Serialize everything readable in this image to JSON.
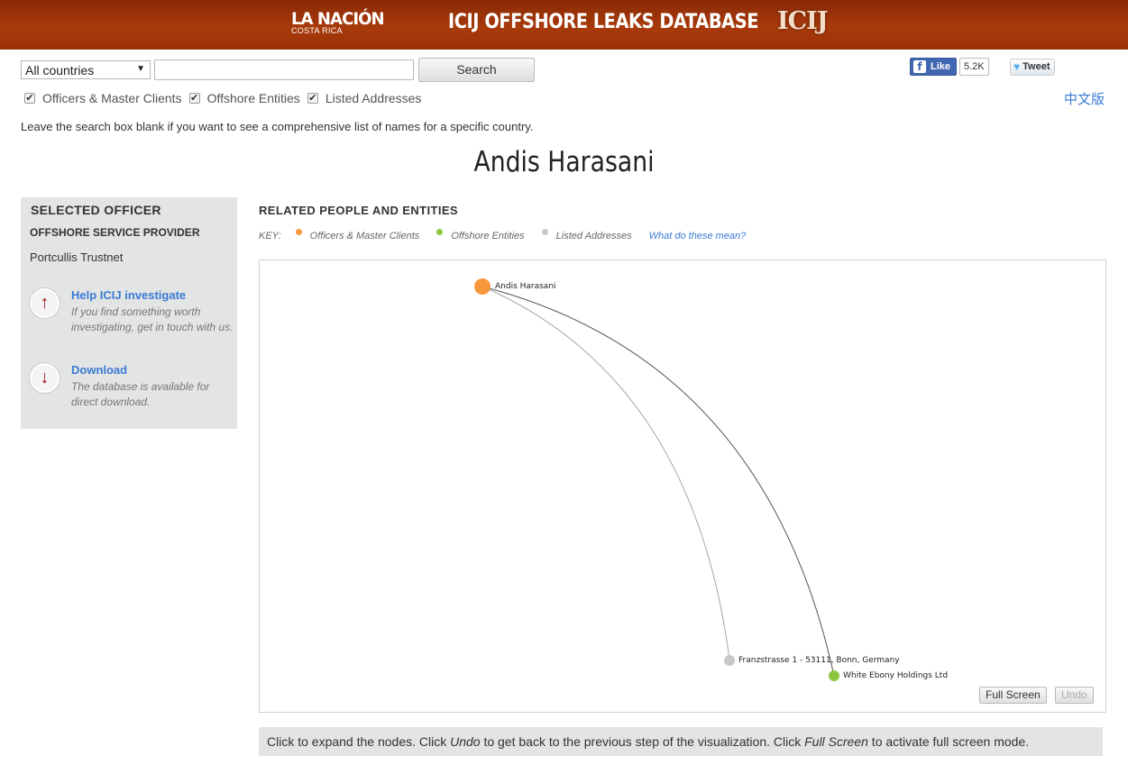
{
  "header": {
    "logo_main": "LA NACIÓN",
    "logo_sub": "COSTA RICA",
    "site_title": "ICIJ OFFSHORE LEAKS DATABASE",
    "logo_icij": "ICIJ"
  },
  "search": {
    "country_selected": "All countries",
    "query_value": "",
    "button_label": "Search",
    "filters": [
      {
        "label": "Officers & Master Clients",
        "checked": true
      },
      {
        "label": "Offshore Entities",
        "checked": true
      },
      {
        "label": "Listed Addresses",
        "checked": true
      }
    ],
    "hint": "Leave the search box blank if you want to see a comprehensive list of names for a specific country."
  },
  "social": {
    "like_label": "Like",
    "like_count": "5.2K",
    "tweet_label": "Tweet",
    "lang_link": "中文版"
  },
  "page_title": "Andis Harasani",
  "sidebar": {
    "title": "SELECTED OFFICER",
    "subtitle": "OFFSHORE SERVICE PROVIDER",
    "value": "Portcullis Trustnet",
    "help_title": "Help ICIJ investigate",
    "help_desc": "If you find something worth investigating, get in touch with us.",
    "download_title": "Download",
    "download_desc": "The database is available for direct download."
  },
  "related": {
    "title": "RELATED PEOPLE AND ENTITIES",
    "key_label": "KEY:",
    "key_items": [
      "Officers & Master Clients",
      "Offshore Entities",
      "Listed Addresses"
    ],
    "key_link": "What do these mean?",
    "colors": {
      "officer": "#f7963b",
      "entity": "#8dc63f",
      "address": "#c8c8c8"
    }
  },
  "graph": {
    "nodes": [
      {
        "label": "Andis Harasani",
        "type": "officer"
      },
      {
        "label": "Franzstrasse 1 - 53111, Bonn, Germany",
        "type": "address"
      },
      {
        "label": "White Ebony Holdings Ltd",
        "type": "entity"
      }
    ],
    "full_screen_label": "Full Screen",
    "undo_label": "Undo"
  },
  "footer": {
    "part1": "Click to expand the nodes. Click ",
    "undo": "Undo",
    "part2": " to get back to the previous step of the visualization. Click ",
    "full": "Full Screen",
    "part3": " to activate full screen mode."
  }
}
